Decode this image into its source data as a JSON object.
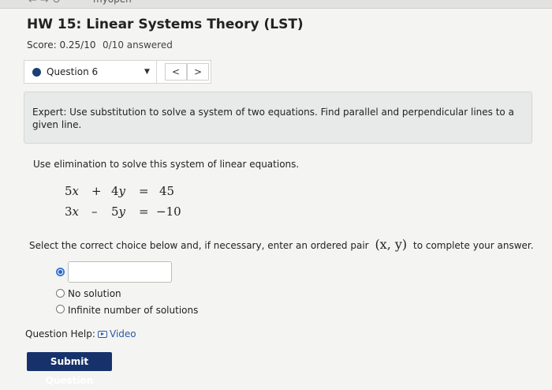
{
  "browser": {
    "url_fragment": "myopen"
  },
  "header": {
    "title": "HW 15: Linear Systems Theory (LST)",
    "score": "Score: 0.25/10",
    "answered": "0/10 answered"
  },
  "question_nav": {
    "selected": "Question 6",
    "prev": "<",
    "next": ">"
  },
  "expert_text": "Expert: Use substitution to solve a system of two equations. Find parallel and perpendicular lines to a given line.",
  "instruction": "Use elimination to solve this system of linear equations.",
  "equations": [
    {
      "a": "5",
      "v1": "x",
      "op": "+",
      "b": "4",
      "v2": "y",
      "eq": "=",
      "rhs": "45"
    },
    {
      "a": "3",
      "v1": "x",
      "op": "–",
      "b": "5",
      "v2": "y",
      "eq": "=",
      "rhs": "−10"
    }
  ],
  "select_prompt": {
    "before": "Select the correct choice below and, if necessary, enter an ordered pair",
    "pair": "(x, y)",
    "after": "to complete your answer."
  },
  "choices": {
    "answer_value": "",
    "option_no_solution": "No solution",
    "option_infinite": "Infinite number of solutions"
  },
  "help": {
    "label": "Question Help:",
    "video": "Video"
  },
  "submit_label": "Submit Question"
}
